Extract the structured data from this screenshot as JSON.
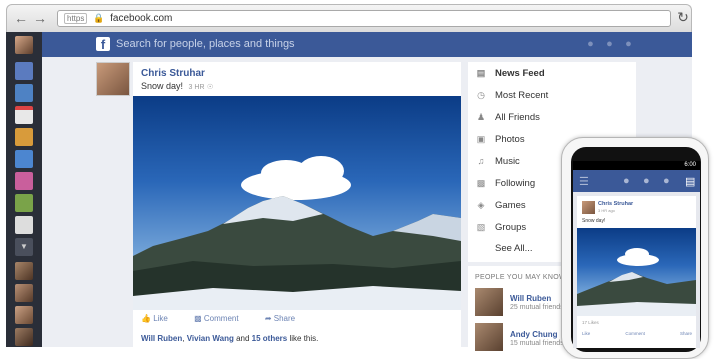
{
  "browser": {
    "back_icon": "arrow-left-icon",
    "forward_icon": "arrow-right-icon",
    "url_scheme": "https",
    "url": "facebook.com",
    "reload_icon": "reload-icon"
  },
  "header": {
    "logo": "f",
    "search_placeholder": "Search for people, places and things",
    "icons": [
      "friend-requests-icon",
      "messages-icon",
      "notifications-icon"
    ]
  },
  "post": {
    "author": "Chris Struhar",
    "text": "Snow day!",
    "time": "3 HR",
    "actions": {
      "like": "Like",
      "comment": "Comment",
      "share": "Share"
    },
    "likes": {
      "names": "Will Ruben",
      "second": "Vivian Wang",
      "and": "and",
      "others": "15 others",
      "suffix": "like this."
    }
  },
  "menu": {
    "items": [
      {
        "label": "News Feed",
        "icon": "news-feed-icon",
        "active": true
      },
      {
        "label": "Most Recent",
        "icon": "clock-icon"
      },
      {
        "label": "All Friends",
        "icon": "friends-icon"
      },
      {
        "label": "Photos",
        "icon": "photos-icon"
      },
      {
        "label": "Music",
        "icon": "music-icon"
      },
      {
        "label": "Following",
        "icon": "following-icon"
      },
      {
        "label": "Games",
        "icon": "games-icon"
      },
      {
        "label": "Groups",
        "icon": "groups-icon"
      },
      {
        "label": "See All...",
        "icon": ""
      }
    ]
  },
  "pymk": {
    "title": "PEOPLE YOU MAY KNOW",
    "people": [
      {
        "name": "Will Ruben",
        "mutual": "25 mutual friends"
      },
      {
        "name": "Andy Chung",
        "mutual": "15 mutual friends"
      }
    ]
  },
  "phone": {
    "time": "6:00",
    "author": "Chris Struhar",
    "post_time": "3 HR ago",
    "text": "Snow day!",
    "likes": "17 Likes",
    "actions": {
      "like": "Like",
      "comment": "Comment",
      "share": "Share"
    }
  },
  "colors": {
    "brand": "#3b5998",
    "rail": "#2a2e38",
    "background": "#eceef3"
  }
}
